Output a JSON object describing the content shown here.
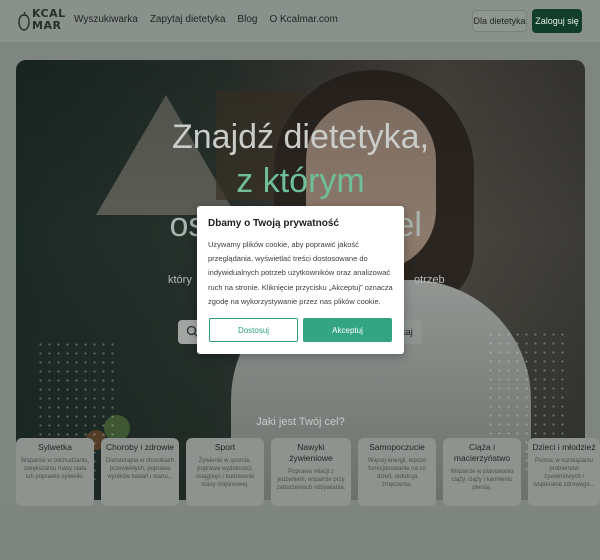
{
  "header": {
    "logo_text": "KCAL\nMAR",
    "nav": [
      "Wyszukiwarka",
      "Zapytaj dietetyka",
      "Blog",
      "O Kcalmar.com"
    ],
    "diet_button": "Dla dietetyka",
    "login_button": "Zaloguj się"
  },
  "hero": {
    "title_line1": "Znajdź dietetyka,",
    "title_line2": "z którym",
    "title_line3_left": "os",
    "title_line3_right": "el",
    "sub_left": "który",
    "sub_right": "otrzeb",
    "search_button": "kaj",
    "goal_label": "Jaki jest Twój cel?"
  },
  "cards": [
    {
      "title": "Sylwetka",
      "desc": "Wsparcie w odchudzaniu, zwiększaniu masy ciała lub poprawie sylwetki."
    },
    {
      "title": "Choroby i zdrowie",
      "desc": "Dietoterapia w chorobach przewlekłych, poprawa wyników badań i stanu..."
    },
    {
      "title": "Sport",
      "desc": "Żywienie w sporcie, poprawa wydolności, osiągnięć i budowanie masy mięśniowej."
    },
    {
      "title": "Nawyki żywieniowe",
      "desc": "Poprawa relacji z jedzeniem, wsparcie przy zaburzeniach odżywiania."
    },
    {
      "title": "Samopoczucie",
      "desc": "Więcej energii, lepsze funkcjonowanie na co dzień, redukcja zmęczenia."
    },
    {
      "title": "Ciąża i macierzyństwo",
      "desc": "Wsparcie w planowaniu ciąży, ciąży i karmieniu piersią."
    },
    {
      "title": "Dzieci i młodzież",
      "desc": "Pomoc w rozwiązaniu problemów żywieniowych i wspieranie zdrowego..."
    }
  ],
  "modal": {
    "title": "Dbamy o Twoją prywatność",
    "body": "Używamy plików cookie, aby poprawić jakość przeglądania, wyświetlać treści dostosowane do indywidualnych potrzeb użytkowników oraz analizować ruch na stronie. Kliknięcie przycisku „Akceptuj” oznacza zgodę na wykorzystywanie przez nas plików cookie.",
    "adjust_button": "Dostosuj",
    "accept_button": "Akceptuj"
  },
  "colors": {
    "accent": "#33a582",
    "login_bg": "#103d2c"
  }
}
